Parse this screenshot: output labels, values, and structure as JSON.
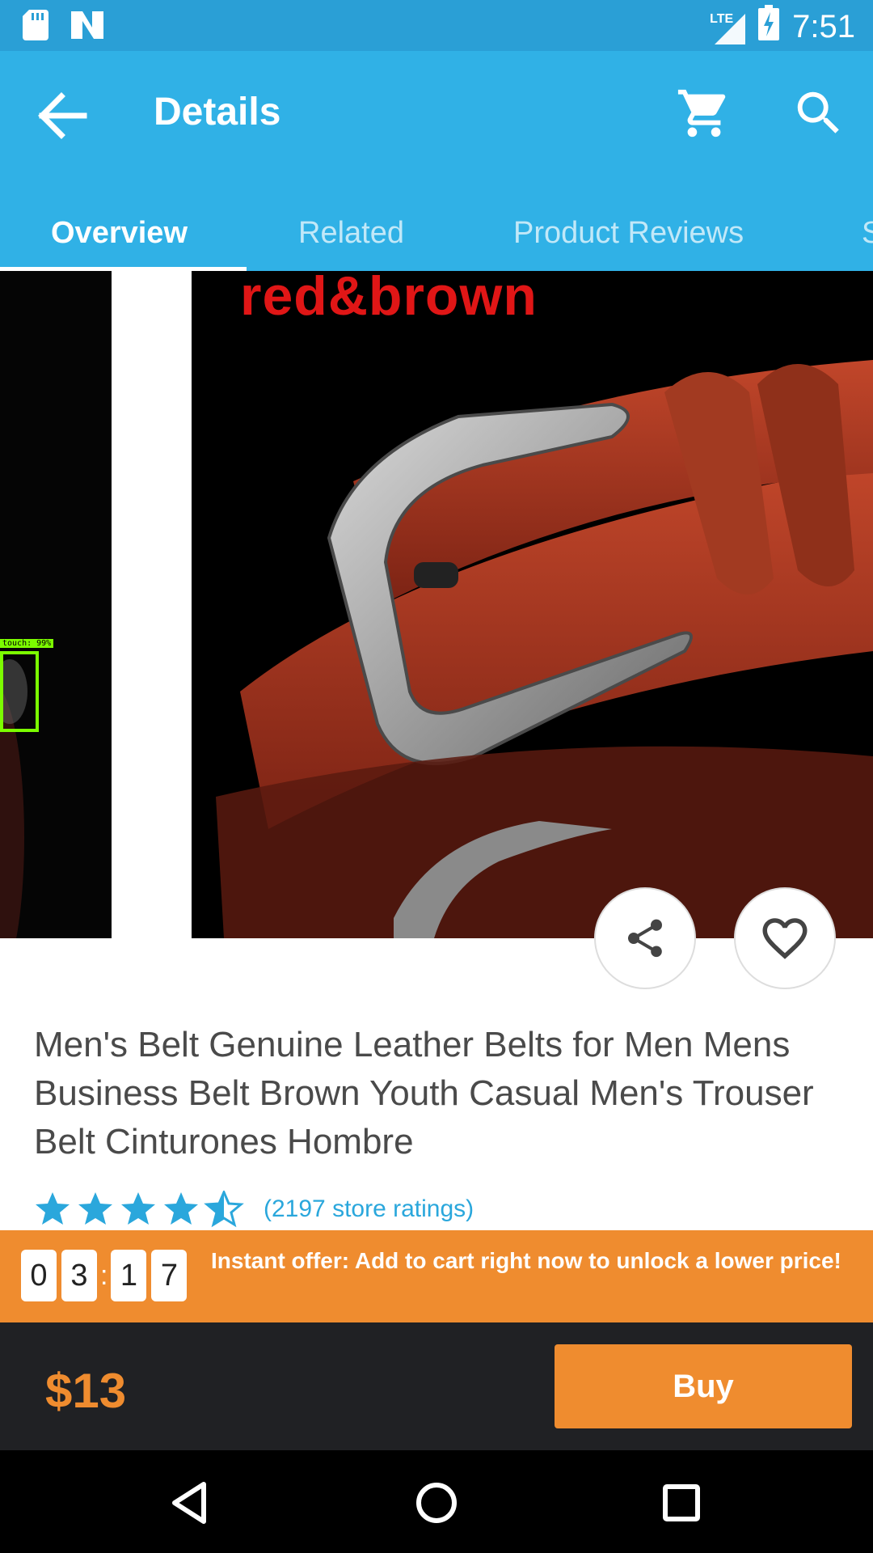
{
  "status_bar": {
    "time": "7:51",
    "network": "LTE",
    "icons": [
      "sd-card-icon",
      "n-notification-icon",
      "signal-icon",
      "battery-charging-icon"
    ]
  },
  "app_bar": {
    "title": "Details",
    "icons": [
      "back-arrow-icon",
      "cart-icon",
      "search-icon"
    ]
  },
  "tabs": [
    {
      "label": "Overview",
      "active": true
    },
    {
      "label": "Related",
      "active": false
    },
    {
      "label": "Product Reviews",
      "active": false
    },
    {
      "label": "S",
      "active": false
    }
  ],
  "gallery": {
    "main_image_text": "red&brown",
    "detection_label": "touch: 99%"
  },
  "product": {
    "title": "Men's Belt Genuine Leather Belts for Men Mens Business Belt Brown Youth Casual Men's Trouser Belt Cinturones Hombre",
    "rating_stars": 4.5,
    "rating_text": "(2197 store ratings)"
  },
  "offer": {
    "countdown": [
      "0",
      "3",
      "1",
      "7"
    ],
    "separator": ":",
    "text": "Instant offer: Add to cart right now to unlock a lower price!"
  },
  "purchase": {
    "price": "$13",
    "buy_label": "Buy"
  },
  "colors": {
    "status_bar": "#2a9fd6",
    "app_bar": "#30b1e6",
    "accent_orange": "#ef8c2f",
    "dark_bar": "#202124",
    "star_blue": "#2aa7dc"
  }
}
